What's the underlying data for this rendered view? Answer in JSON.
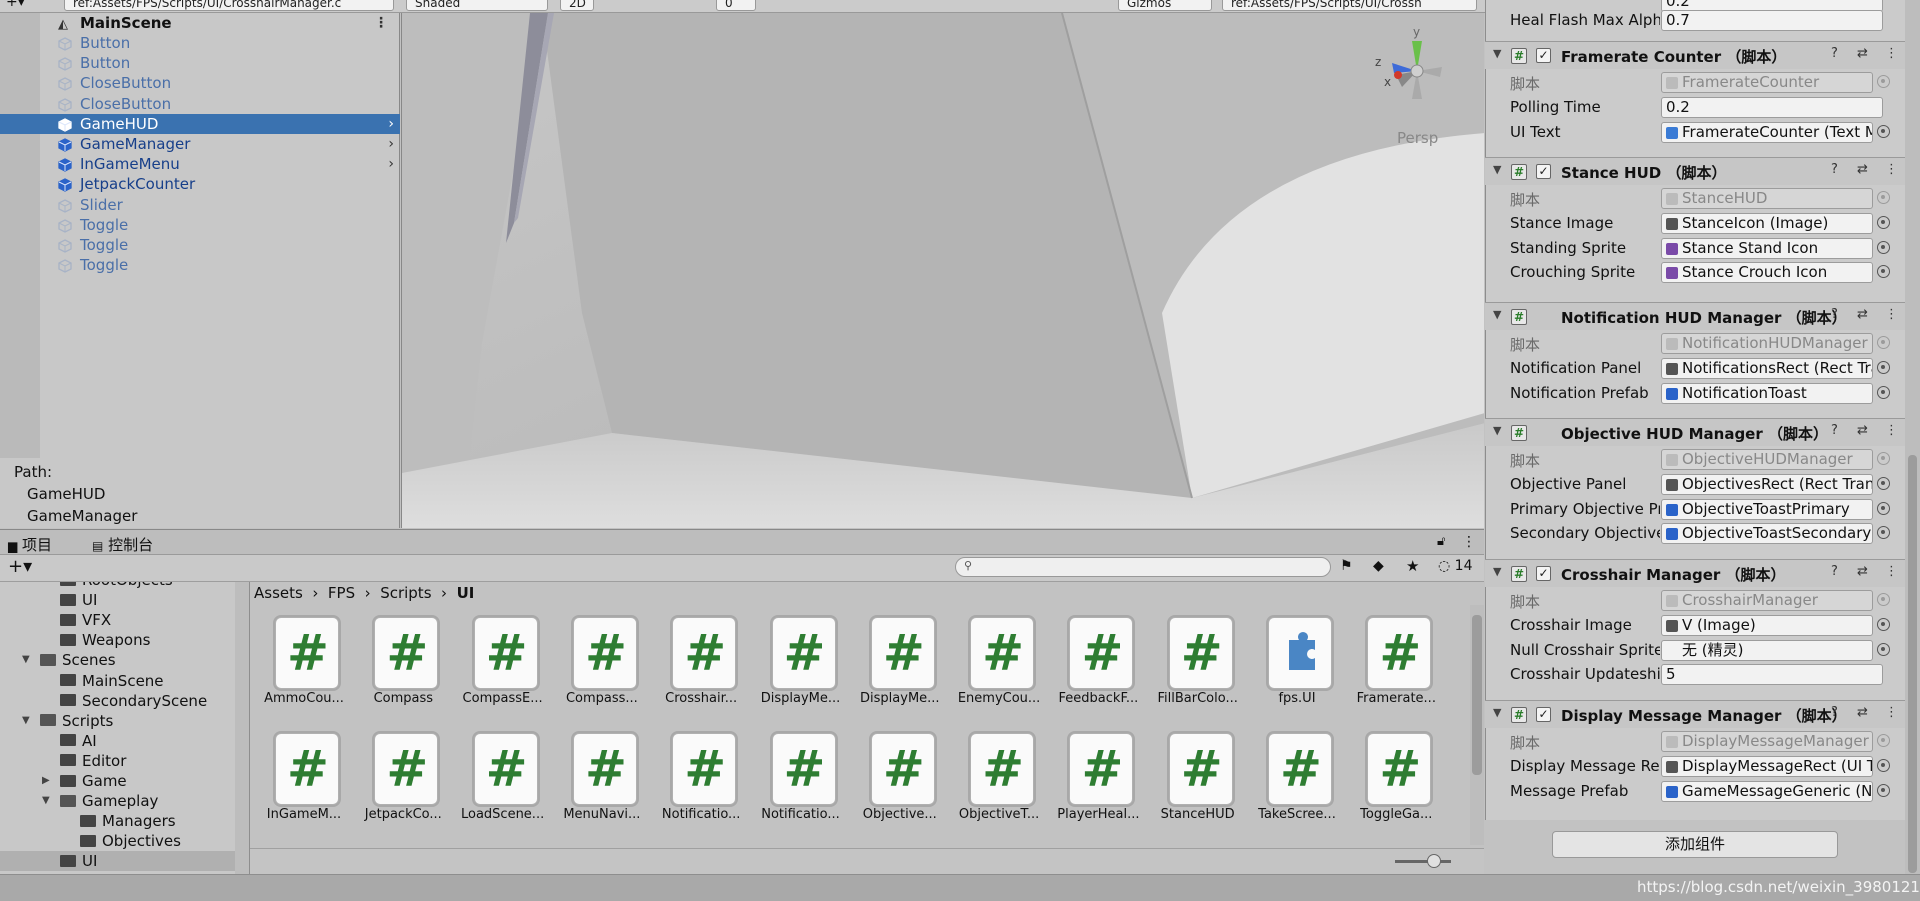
{
  "top_bar": {
    "hierarchy_search": "ref:Assets/FPS/Scripts/UI/CrosshairManager.c",
    "shading_mode": "Shaded",
    "mode_2d": "2D",
    "hidden_count": "0",
    "gizmos": "Gizmos",
    "scene_search": "ref:Assets/FPS/Scripts/UI/Crossh"
  },
  "hierarchy": {
    "scene_name": "MainScene",
    "items": [
      {
        "label": "Button",
        "state": "inactive"
      },
      {
        "label": "Button",
        "state": "inactive"
      },
      {
        "label": "CloseButton",
        "state": "inactive"
      },
      {
        "label": "CloseButton",
        "state": "inactive"
      },
      {
        "label": "GameHUD",
        "state": "selected"
      },
      {
        "label": "GameManager",
        "state": "active"
      },
      {
        "label": "InGameMenu",
        "state": "active"
      },
      {
        "label": "JetpackCounter",
        "state": "prefab"
      },
      {
        "label": "Slider",
        "state": "inactive"
      },
      {
        "label": "Toggle",
        "state": "inactive"
      },
      {
        "label": "Toggle",
        "state": "inactive"
      },
      {
        "label": "Toggle",
        "state": "inactive"
      }
    ],
    "path_label": "Path:",
    "path_items": [
      "GameHUD",
      "GameManager"
    ]
  },
  "scene_view": {
    "camera_mode": "Persp",
    "axis_x": "x",
    "axis_y": "y",
    "axis_z": "z"
  },
  "inspector": {
    "top_field": {
      "label": "Heal Flash Max Alph",
      "value": "0.7",
      "partial_value": "0.2"
    },
    "script_label": "脚本",
    "components": [
      {
        "title": "Framerate Counter （脚本）",
        "enabled": true,
        "script": "FramerateCounter",
        "props": [
          {
            "label": "Polling Time",
            "value": "0.2",
            "type": "text"
          },
          {
            "label": "UI Text",
            "value": "FramerateCounter (Text M",
            "type": "object",
            "icon": "text-icon"
          }
        ]
      },
      {
        "title": "Stance HUD （脚本）",
        "enabled": true,
        "script": "StanceHUD",
        "props": [
          {
            "label": "Stance Image",
            "value": "StanceIcon (Image)",
            "type": "object",
            "icon": "image-icon"
          },
          {
            "label": "Standing Sprite",
            "value": "Stance Stand Icon",
            "type": "object",
            "icon": "sprite-icon"
          },
          {
            "label": "Crouching Sprite",
            "value": "Stance Crouch Icon",
            "type": "object",
            "icon": "sprite-icon"
          }
        ]
      },
      {
        "title": "Notification HUD Manager （脚本）",
        "enabled": false,
        "script": "NotificationHUDManager",
        "props": [
          {
            "label": "Notification Panel",
            "value": "NotificationsRect (Rect Tra",
            "type": "object",
            "icon": "rect-icon"
          },
          {
            "label": "Notification Prefab",
            "value": "NotificationToast",
            "type": "object",
            "icon": "prefab-icon"
          }
        ]
      },
      {
        "title": "Objective HUD Manager （脚本）",
        "enabled": false,
        "script": "ObjectiveHUDManager",
        "props": [
          {
            "label": "Objective Panel",
            "value": "ObjectivesRect (Rect Trans",
            "type": "object",
            "icon": "rect-icon"
          },
          {
            "label": "Primary Objective Pr",
            "value": "ObjectiveToastPrimary",
            "type": "object",
            "icon": "prefab-icon"
          },
          {
            "label": "Secondary Objective",
            "value": "ObjectiveToastSecondary",
            "type": "object",
            "icon": "prefab-icon"
          }
        ]
      },
      {
        "title": "Crosshair Manager （脚本）",
        "enabled": true,
        "script": "CrosshairManager",
        "props": [
          {
            "label": "Crosshair Image",
            "value": "V (Image)",
            "type": "object",
            "icon": "image-icon"
          },
          {
            "label": "Null Crosshair Sprite",
            "value": "无 (精灵)",
            "type": "object",
            "icon": "none"
          },
          {
            "label": "Crosshair Updateshi",
            "value": "5",
            "type": "text"
          }
        ]
      },
      {
        "title": "Display Message Manager （脚本）",
        "enabled": true,
        "script": "DisplayMessageManager",
        "props": [
          {
            "label": "Display Message Re",
            "value": "DisplayMessageRect (UI T",
            "type": "object",
            "icon": "rect-icon"
          },
          {
            "label": "Message Prefab",
            "value": "GameMessageGeneric (N",
            "type": "object",
            "icon": "prefab-icon"
          }
        ]
      }
    ],
    "add_component": "添加组件"
  },
  "project": {
    "tab_project": "项目",
    "tab_console": "控制台",
    "hidden_packages_count": "14",
    "tree": [
      {
        "label": "RootObjects",
        "depth": 3,
        "fold": "none"
      },
      {
        "label": "UI",
        "depth": 3,
        "fold": "none"
      },
      {
        "label": "VFX",
        "depth": 3,
        "fold": "none"
      },
      {
        "label": "Weapons",
        "depth": 3,
        "fold": "none"
      },
      {
        "label": "Scenes",
        "depth": 2,
        "fold": "open"
      },
      {
        "label": "MainScene",
        "depth": 3,
        "fold": "none"
      },
      {
        "label": "SecondaryScene",
        "depth": 3,
        "fold": "none"
      },
      {
        "label": "Scripts",
        "depth": 2,
        "fold": "open"
      },
      {
        "label": "AI",
        "depth": 3,
        "fold": "none"
      },
      {
        "label": "Editor",
        "depth": 3,
        "fold": "none"
      },
      {
        "label": "Game",
        "depth": 3,
        "fold": "closed"
      },
      {
        "label": "Gameplay",
        "depth": 3,
        "fold": "open"
      },
      {
        "label": "Managers",
        "depth": 4,
        "fold": "none"
      },
      {
        "label": "Objectives",
        "depth": 4,
        "fold": "none"
      },
      {
        "label": "UI",
        "depth": 3,
        "fold": "none",
        "selected": true
      }
    ],
    "breadcrumb": [
      "Assets",
      "FPS",
      "Scripts",
      "UI"
    ],
    "assets_row1": [
      "AmmoCou...",
      "Compass",
      "CompassE...",
      "Compass...",
      "Crosshair...",
      "DisplayMe...",
      "DisplayMe...",
      "EnemyCou...",
      "FeedbackF...",
      "FillBarColo...",
      "fps.UI",
      "Framerate..."
    ],
    "assets_row2": [
      "InGameM...",
      "JetpackCo...",
      "LoadScene...",
      "MenuNavi...",
      "Notificatio...",
      "Notificatio...",
      "Objective...",
      "ObjectiveT...",
      "PlayerHeal...",
      "StanceHUD",
      "TakeScree...",
      "ToggleGa..."
    ]
  },
  "watermark": "https://blog.csdn.net/weixin_39801219"
}
